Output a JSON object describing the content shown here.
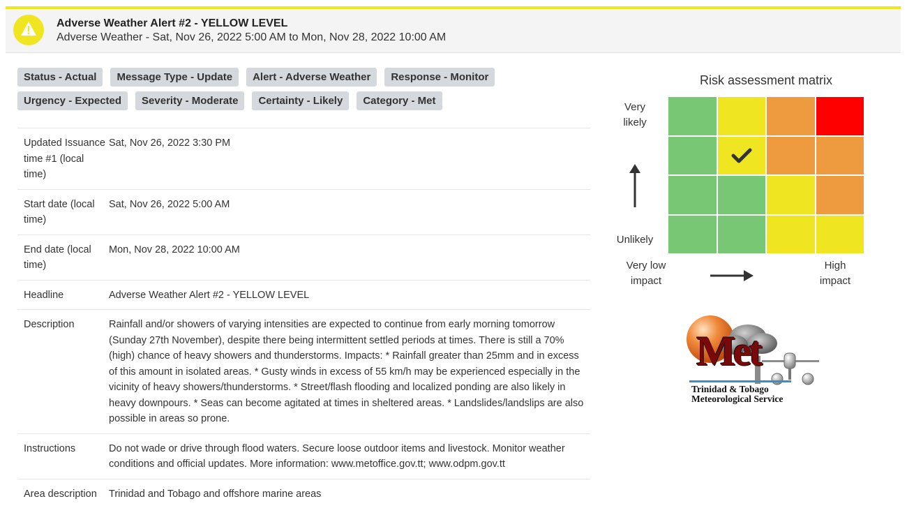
{
  "header": {
    "title": "Adverse Weather Alert #2 - YELLOW LEVEL",
    "subtitle": "Adverse Weather - Sat, Nov 26, 2022 5:00 AM to Mon, Nov 28, 2022 10:00 AM",
    "icon": "warning-triangle-icon",
    "level_color": "#f0e521"
  },
  "tags": {
    "row1": [
      "Status - Actual",
      "Message Type - Update",
      "Alert - Adverse Weather",
      "Response - Monitor"
    ],
    "row2": [
      "Urgency - Expected",
      "Severity - Moderate",
      "Certainty - Likely",
      "Category - Met"
    ]
  },
  "details": [
    {
      "label": "Updated Issuance time #1 (local time)",
      "value": "Sat, Nov 26, 2022 3:30 PM"
    },
    {
      "label": "Start date (local time)",
      "value": "Sat, Nov 26, 2022 5:00 AM"
    },
    {
      "label": "End date (local time)",
      "value": "Mon, Nov 28, 2022 10:00 AM"
    },
    {
      "label": "Headline",
      "value": "Adverse Weather Alert #2 - YELLOW LEVEL"
    },
    {
      "label": "Description",
      "value": "Rainfall and/or showers of varying intensities are expected to continue from early morning tomorrow (Sunday 27th November), despite there being intermittent settled periods at times. There is still a 70% (high) chance of heavy showers and thunderstorms. Impacts: * Rainfall greater than 25mm and in excess of this amount in isolated areas. * Gusty winds in excess of 55 km/h may be experienced especially in the vicinity of heavy showers/thunderstorms. * Street/flash flooding and localized ponding are also likely in heavy downpours. * Seas can become agitated at times in sheltered areas. * Landslides/landslips are also possible in areas so prone."
    },
    {
      "label": "Instructions",
      "value": "Do not wade or drive through flood waters. Secure loose outdoor items and livestock. Monitor weather conditions and official updates. More information: www.metoffice.gov.tt; www.odpm.gov.tt"
    },
    {
      "label": "Area description",
      "value": "Trinidad and Tobago and offshore marine areas"
    }
  ],
  "risk_matrix": {
    "title": "Risk assessment matrix",
    "y_top": "Very likely",
    "y_bottom": "Unlikely",
    "x_left": "Very low impact",
    "x_right": "High impact",
    "colors": {
      "green": "#77c775",
      "yellow": "#f0e521",
      "orange": "#ee9a3f",
      "red": "#ff0000"
    },
    "rows": [
      [
        "green",
        "yellow",
        "orange",
        "red"
      ],
      [
        "green",
        "yellow",
        "orange",
        "orange"
      ],
      [
        "green",
        "green",
        "yellow",
        "orange"
      ],
      [
        "green",
        "green",
        "yellow",
        "yellow"
      ]
    ],
    "selected": {
      "row": 1,
      "col": 1
    }
  },
  "logo": {
    "mark": "Met",
    "line1": "Trinidad & Tobago",
    "line2": "Meteorological Service"
  }
}
